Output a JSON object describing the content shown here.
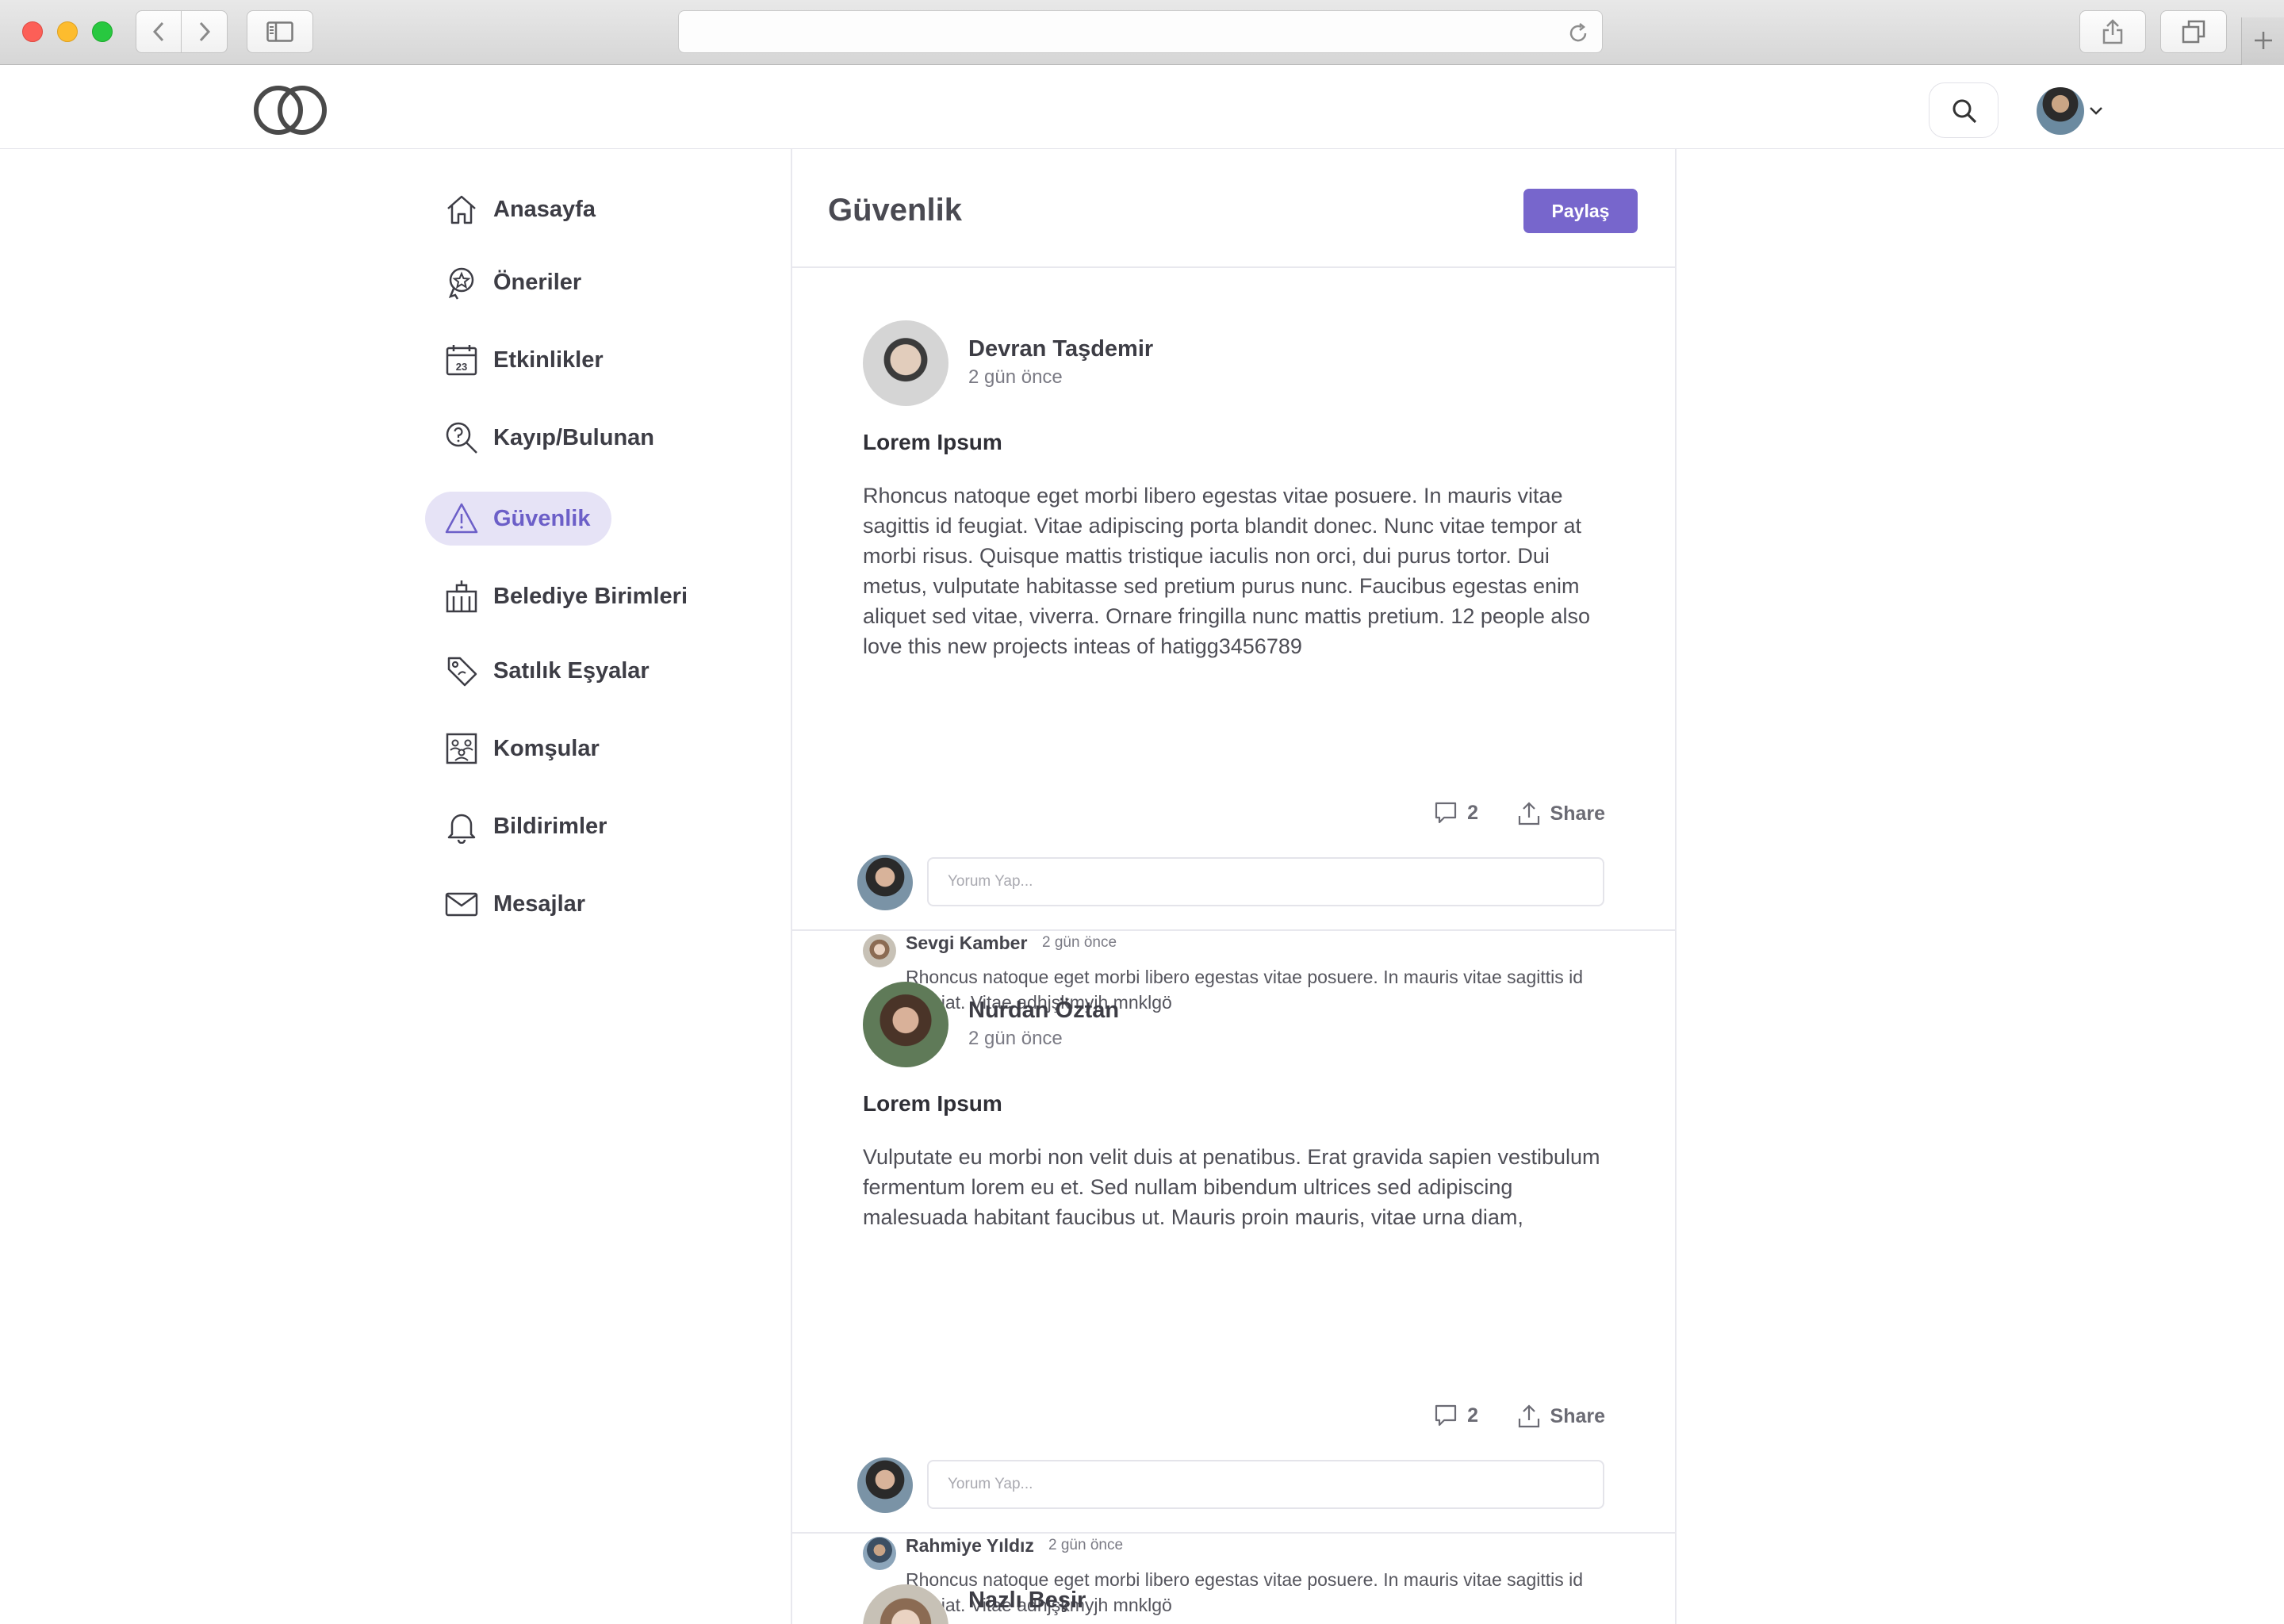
{
  "browser": {
    "address": ""
  },
  "header": {
    "logo": "logo-rings-icon",
    "search_icon": "search-icon"
  },
  "nav": {
    "items": [
      {
        "label": "Anasayfa",
        "icon": "home-icon",
        "active": false
      },
      {
        "label": "Öneriler",
        "icon": "recommend-icon",
        "active": false
      },
      {
        "label": "Etkinlikler",
        "icon": "calendar-icon",
        "active": false
      },
      {
        "label": "Kayıp/Bulunan",
        "icon": "lost-found-icon",
        "active": false
      },
      {
        "label": "Güvenlik",
        "icon": "warning-icon",
        "active": true
      },
      {
        "label": "Belediye Birimleri",
        "icon": "municipality-icon",
        "active": false
      },
      {
        "label": "Satılık Eşyalar",
        "icon": "tag-icon",
        "active": false
      },
      {
        "label": "Komşular",
        "icon": "neighbors-icon",
        "active": false
      },
      {
        "label": "Bildirimler",
        "icon": "bell-icon",
        "active": false
      },
      {
        "label": "Mesajlar",
        "icon": "mail-icon",
        "active": false
      }
    ]
  },
  "page": {
    "title": "Güvenlik",
    "share_button": "Paylaş"
  },
  "posts": [
    {
      "author": "Devran Taşdemir",
      "time": "2 gün önce",
      "title": "Lorem Ipsum",
      "body": "Rhoncus natoque eget morbi libero egestas vitae posuere. In mauris vitae sagittis id feugiat. Vitae adipiscing porta blandit donec. Nunc vitae tempor at morbi risus. Quisque mattis tristique iaculis non orci, dui purus tortor. Dui metus, vulputate habitasse sed pretium purus nunc. Faucibus egestas enim aliquet sed vitae, viverra. Ornare fringilla nunc mattis pretium. 12 people also love this new projects inteas of hatigg3456789",
      "comments_count": "2",
      "share_label": "Share",
      "comment_placeholder": "Yorum Yap...",
      "reply": {
        "author": "Sevgi Kamber",
        "time": "2 gün önce",
        "text": "Rhoncus natoque eget morbi libero egestas vitae posuere. In mauris vitae sagittis id feugiat. Vitae adhjşkmyjh mnklgö"
      }
    },
    {
      "author": "Nurdan Öztan",
      "time": "2 gün önce",
      "title": "Lorem Ipsum",
      "body": "Vulputate eu morbi non velit duis at penatibus. Erat gravida sapien vestibulum fermentum lorem eu et. Sed nullam bibendum ultrices sed adipiscing malesuada habitant faucibus ut. Mauris proin mauris, vitae urna diam,",
      "comments_count": "2",
      "share_label": "Share",
      "comment_placeholder": "Yorum Yap...",
      "reply": {
        "author": "Rahmiye Yıldız",
        "time": "2 gün önce",
        "text": "Rhoncus natoque eget morbi libero egestas vitae posuere. In mauris vitae sagittis id feugiat. Vitae adhjşkmyjh mnklgö"
      }
    },
    {
      "author": "Nazlı Beşir"
    }
  ],
  "colors": {
    "accent": "#7766cc",
    "active_nav_bg": "#e6e3f6",
    "active_nav_text": "#6c5fc8"
  }
}
